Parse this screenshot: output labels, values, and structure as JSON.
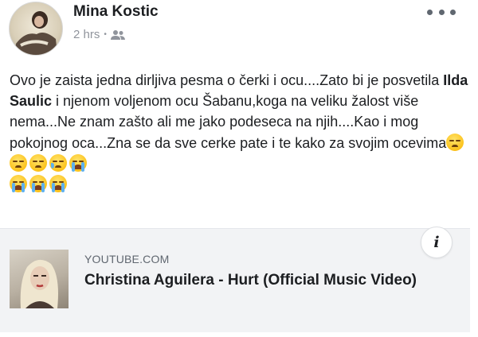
{
  "post": {
    "author": "Mina Kostic",
    "time": "2 hrs",
    "separator": "•",
    "audience_icon": "friends-icon",
    "more_icon": "more-horizontal-icon",
    "text_part1": "Ovo je zaista jedna dirljiva pesma o čerki i ocu....Zato bi je posvetila ",
    "text_bold": "Ilda Saulic",
    "text_part2": " i njenom voljenom ocu Šabanu,koga na veliku žalost više nema...Ne znam zašto ali me jako podeseca na njih....Kao i mog pokojnog oca...Zna se da sve cerke pate i te kako za svojim ocevima",
    "emojis": [
      "pensive-face",
      "pensive-face",
      "pensive-face",
      "crying-face",
      "sobbing-face",
      "sobbing-face",
      "sobbing-face",
      "sobbing-face"
    ]
  },
  "link_preview": {
    "domain": "YOUTUBE.COM",
    "title": "Christina Aguilera - Hurt (Official Music Video)",
    "info_label": "i"
  },
  "colors": {
    "text": "#1c1e21",
    "meta": "#90949c",
    "card_bg": "#f2f3f5"
  }
}
